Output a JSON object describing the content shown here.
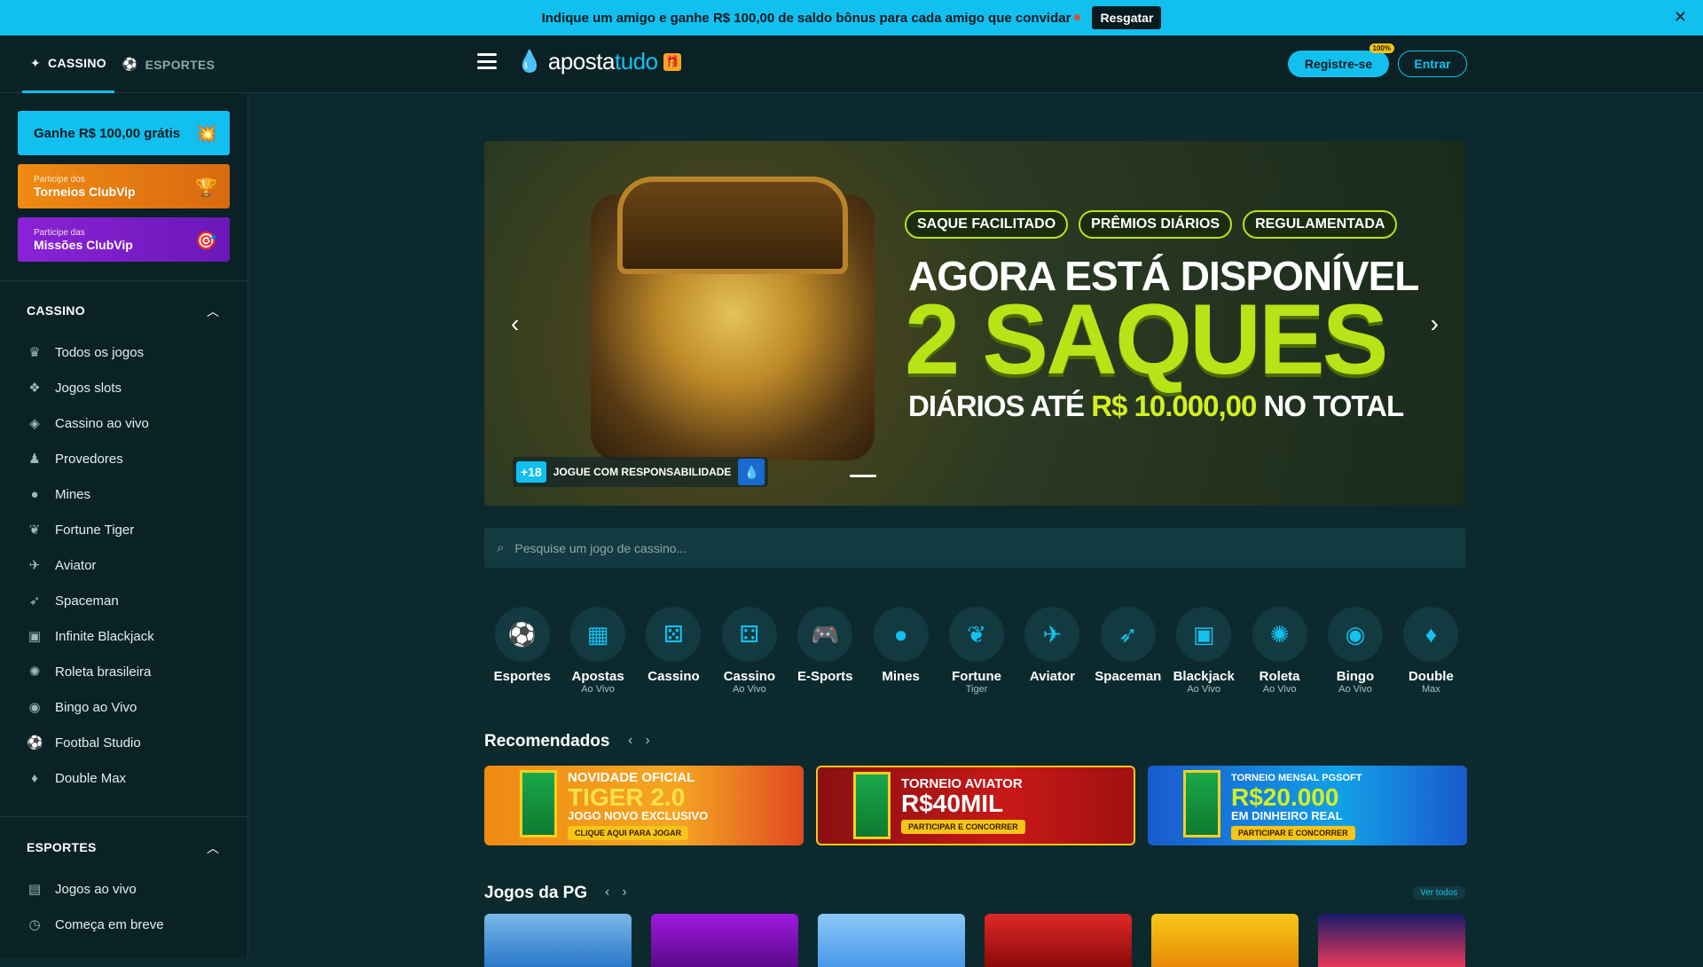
{
  "topbar": {
    "promo_text": "Indique um amigo e ganhe R$ 100,00 de saldo bônus para cada amigo que convidar",
    "resgatar_label": "Resgatar"
  },
  "header": {
    "tabs": [
      {
        "label": "CASSINO",
        "icon": "cassino-icon"
      },
      {
        "label": "ESPORTES",
        "icon": "soccer-ball-icon"
      }
    ],
    "logo_text_a": "aposta",
    "logo_text_b": "tudo",
    "register_label": "Registre-se",
    "register_badge": "100%",
    "login_label": "Entrar"
  },
  "sidebar": {
    "promo1": "Ganhe R$ 100,00 grátis",
    "promo2_small": "Participe dos",
    "promo2_large": "Torneios ClubVip",
    "promo3_small": "Participe das",
    "promo3_large": "Missões ClubVip",
    "cassino_title": "CASSINO",
    "cassino_items": [
      {
        "label": "Todos os jogos",
        "icon": "crown-icon"
      },
      {
        "label": "Jogos slots",
        "icon": "slots-icon"
      },
      {
        "label": "Cassino ao vivo",
        "icon": "live-casino-icon"
      },
      {
        "label": "Provedores",
        "icon": "provider-icon"
      },
      {
        "label": "Mines",
        "icon": "bomb-icon"
      },
      {
        "label": "Fortune Tiger",
        "icon": "paw-icon"
      },
      {
        "label": "Aviator",
        "icon": "plane-icon"
      },
      {
        "label": "Spaceman",
        "icon": "rocket-icon"
      },
      {
        "label": "Infinite Blackjack",
        "icon": "card-icon"
      },
      {
        "label": "Roleta brasileira",
        "icon": "roulette-icon"
      },
      {
        "label": "Bingo ao Vivo",
        "icon": "bingo-icon"
      },
      {
        "label": "Footbal Studio",
        "icon": "football-icon"
      },
      {
        "label": "Double Max",
        "icon": "drop-icon"
      }
    ],
    "esportes_title": "ESPORTES",
    "esportes_items": [
      {
        "label": "Jogos ao vivo",
        "icon": "live-icon"
      },
      {
        "label": "Começa em breve",
        "icon": "clock-icon"
      }
    ]
  },
  "banner": {
    "pills": [
      "SAQUE FACILITADO",
      "PRÊMIOS DIÁRIOS",
      "REGULAMENTADA"
    ],
    "headline1": "AGORA ESTÁ DISPONÍVEL",
    "headline2": "2 SAQUES",
    "headline3_a": "DIÁRIOS ATÉ",
    "headline3_b": "R$ 10.000,00",
    "headline3_c": "NO TOTAL",
    "age": "+18",
    "responsibility": "JOGUE COM RESPONSABILIDADE"
  },
  "search": {
    "placeholder": "Pesquise um jogo de cassino..."
  },
  "categories": [
    {
      "name": "Esportes",
      "sub": "",
      "icon": "soccer-ball-icon"
    },
    {
      "name": "Apostas",
      "sub": "Ao Vivo",
      "icon": "live-bets-icon"
    },
    {
      "name": "Cassino",
      "sub": "",
      "icon": "dice-icon"
    },
    {
      "name": "Cassino",
      "sub": "Ao Vivo",
      "icon": "live-dice-icon"
    },
    {
      "name": "E-Sports",
      "sub": "",
      "icon": "gamepad-icon"
    },
    {
      "name": "Mines",
      "sub": "",
      "icon": "bomb-icon"
    },
    {
      "name": "Fortune",
      "sub": "Tiger",
      "icon": "paw-icon"
    },
    {
      "name": "Aviator",
      "sub": "",
      "icon": "plane-icon"
    },
    {
      "name": "Spaceman",
      "sub": "",
      "icon": "rocket-icon"
    },
    {
      "name": "Blackjack",
      "sub": "Ao Vivo",
      "icon": "card-icon"
    },
    {
      "name": "Roleta",
      "sub": "Ao Vivo",
      "icon": "roulette-icon"
    },
    {
      "name": "Bingo",
      "sub": "Ao Vivo",
      "icon": "bingo-icon"
    },
    {
      "name": "Double",
      "sub": "Max",
      "icon": "drop-icon"
    }
  ],
  "recomendados": {
    "title": "Recomendados",
    "cards": [
      {
        "l1": "NOVIDADE OFICIAL",
        "l2": "TIGER 2.0",
        "l3": "JOGO NOVO EXCLUSIVO",
        "cta": "CLIQUE AQUI PARA JOGAR"
      },
      {
        "l1": "TORNEIO AVIATOR",
        "l2": "R$40MIL",
        "l3": "",
        "cta": "PARTICIPAR E CONCORRER"
      },
      {
        "l1": "TORNEIO MENSAL PGSOFT",
        "l2": "R$20.000",
        "l3": "EM DINHEIRO REAL",
        "cta": "PARTICIPAR E CONCORRER"
      }
    ]
  },
  "pg": {
    "title": "Jogos da PG",
    "ver_todos": "Ver todos"
  },
  "colors": {
    "accent": "#12c0ef",
    "background": "#0c2a2e",
    "lime": "#b8e316"
  }
}
